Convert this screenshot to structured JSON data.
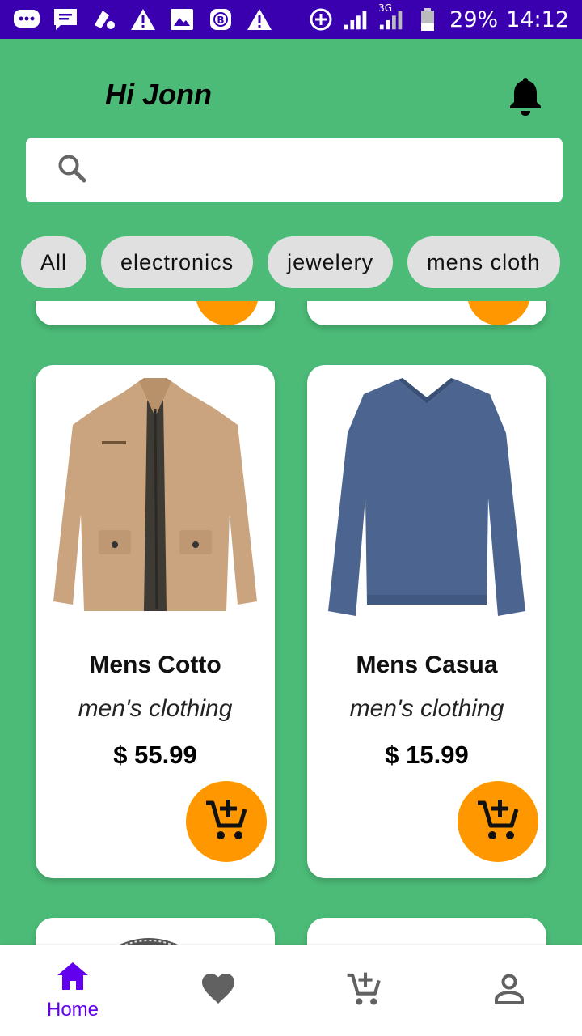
{
  "status_bar": {
    "battery": "29%",
    "time": "14:12",
    "network": "3G",
    "left_icons": [
      "message-icon",
      "sms-icon",
      "paint-icon",
      "warning-icon",
      "image-icon",
      "b-icon",
      "warning-icon"
    ]
  },
  "header": {
    "greeting": "Hi Jonn"
  },
  "search": {
    "placeholder": "",
    "value": ""
  },
  "categories": [
    "All",
    "electronics",
    "jewelery",
    "mens cloth"
  ],
  "products": [
    {
      "title": "Mens Cotto",
      "category": "men's clothing",
      "price": "$ 55.99",
      "image": "jacket-image"
    },
    {
      "title": "Mens Casua",
      "category": "men's clothing",
      "price": "$ 15.99",
      "image": "long-sleeve-shirt-image"
    }
  ],
  "bottom_nav": [
    {
      "label": "Home",
      "icon": "home-icon",
      "active": true
    },
    {
      "label": "",
      "icon": "heart-icon",
      "active": false
    },
    {
      "label": "",
      "icon": "add-cart-icon",
      "active": false
    },
    {
      "label": "",
      "icon": "person-icon",
      "active": false
    }
  ],
  "colors": {
    "background": "#4cbb78",
    "status_bar": "#3a00b0",
    "accent": "#ff9800",
    "active_nav": "#6200ee",
    "chip": "#e0e0e0"
  }
}
